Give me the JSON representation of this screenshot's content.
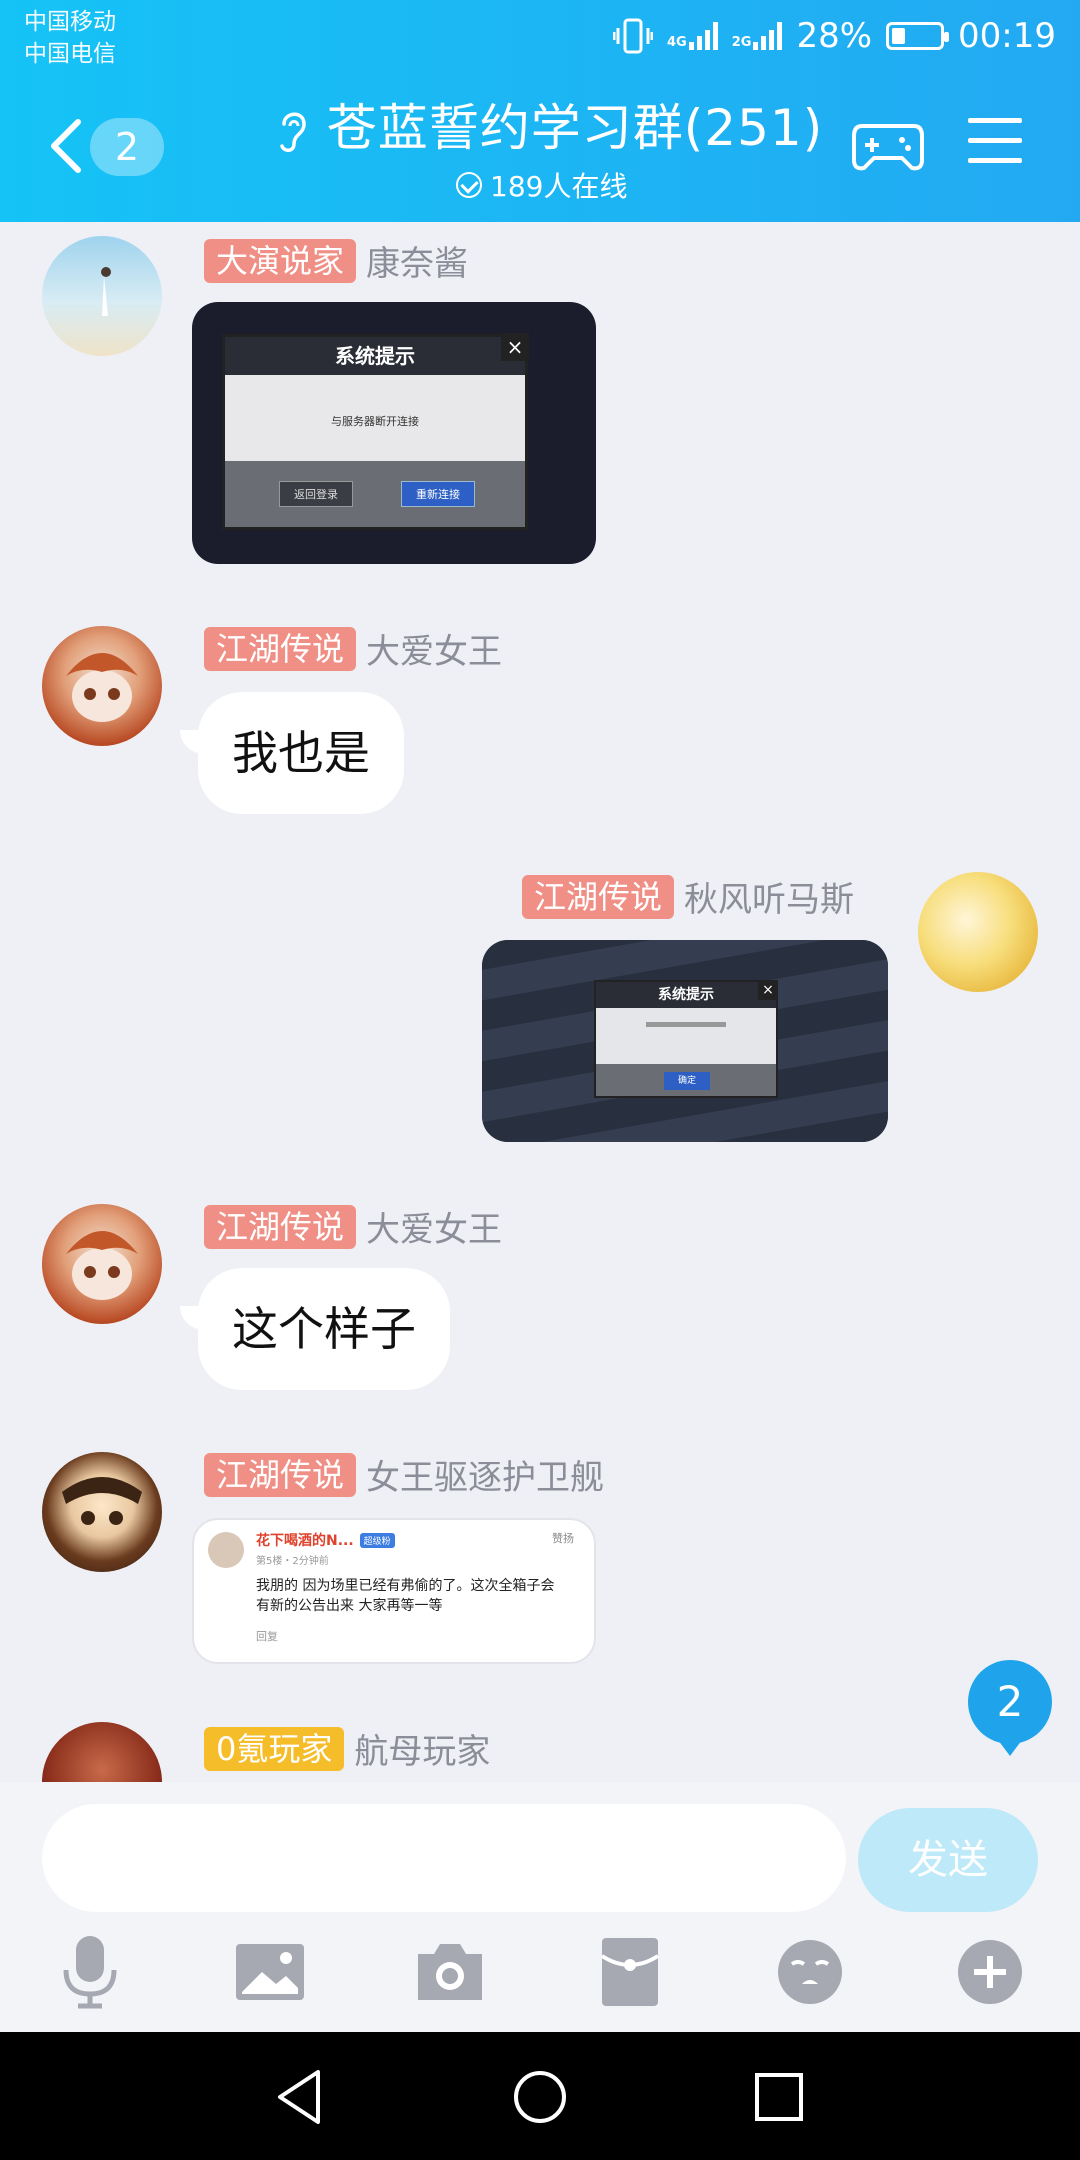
{
  "status_bar": {
    "carrier_1": "中国移动",
    "carrier_2": "中国电信",
    "net_1": "4G",
    "net_2": "2G",
    "battery": "28%",
    "battery_level": 0.28,
    "time": "00:19"
  },
  "header": {
    "unread_count": "2",
    "title": "苍蓝誓约学习群(251)",
    "online": "189人在线"
  },
  "messages": [
    {
      "tag": "大演说家",
      "name": "康奈酱"
    },
    {
      "tag": "江湖传说",
      "name": "大爱女王",
      "text": "我也是"
    },
    {
      "tag": "江湖传说",
      "name": "秋风听马斯"
    },
    {
      "tag": "江湖传说",
      "name": "大爱女王",
      "text": "这个样子"
    },
    {
      "tag": "江湖传说",
      "name": "女王驱逐护卫舰"
    },
    {
      "tag": "0氪玩家",
      "name": "航母玩家"
    }
  ],
  "image1": {
    "title": "系统提示",
    "body": "与服务器断开连接",
    "btn_left": "返回登录",
    "btn_right": "重新连接"
  },
  "image2": {
    "title": "系统提示",
    "ok": "确定"
  },
  "image3": {
    "user": "花下喝酒的N...",
    "badge": "超级粉",
    "like": "赞扬",
    "floor": "第5楼・2分钟前",
    "line1": "我朋的 因为场里已经有弗偷的了。这次全箱子会",
    "line2": "有新的公告出来 大家再等一等",
    "reply": "回复"
  },
  "new_message_count": "2",
  "input": {
    "placeholder": "",
    "send": "发送"
  },
  "colors": {
    "header_start": "#15c3f6",
    "header_end": "#23a9f2",
    "tag_red": "#f08f86",
    "tag_gold": "#f6bd2b",
    "send_disabled": "#bde9f9"
  }
}
